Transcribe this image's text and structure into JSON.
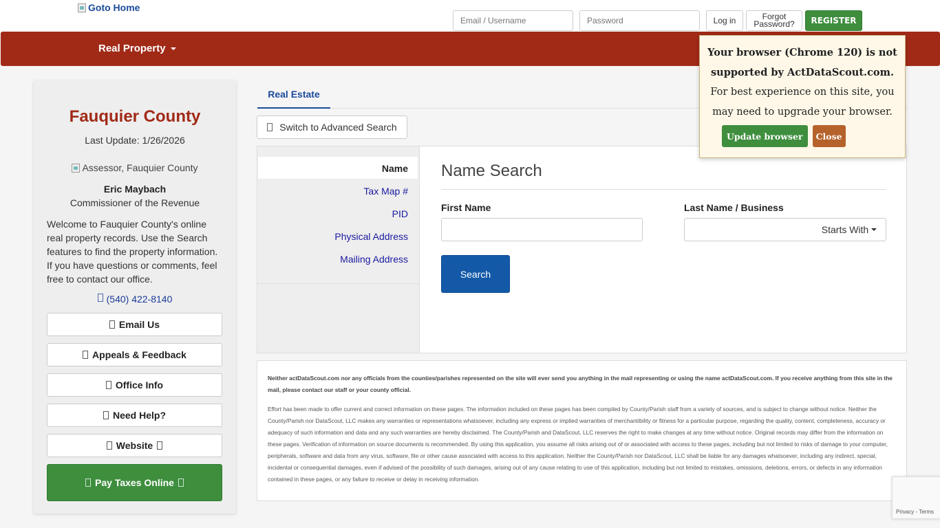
{
  "header": {
    "logo_alt": "Goto Home",
    "email_placeholder": "Email / Username",
    "password_placeholder": "Password",
    "login_label": "Log in",
    "forgot_line1": "Forgot",
    "forgot_line2": "Password?",
    "register_label": "REGISTER"
  },
  "nav": {
    "real_property_label": "Real Property"
  },
  "sidebar": {
    "county": "Fauquier County",
    "last_update": "Last Update: 1/26/2026",
    "assessor_img_alt": "Assessor, Fauquier County",
    "official_name": "Eric Maybach",
    "official_title": "Commissioner of the Revenue",
    "welcome": "Welcome to Fauquier County's online real property records. Use the Search features to find the property information. If you have questions or comments, feel free to contact our office.",
    "phone": "(540) 422-8140",
    "buttons": {
      "email": "Email Us",
      "appeals": "Appeals & Feedback",
      "office": "Office Info",
      "help": "Need Help?",
      "website": "Website"
    },
    "pay_taxes": "Pay Taxes Online"
  },
  "tabs": {
    "real_estate": "Real Estate"
  },
  "advanced_search_label": "Switch to Advanced Search",
  "search": {
    "options": [
      "Name",
      "Tax Map #",
      "PID",
      "Physical Address",
      "Mailing Address"
    ],
    "title": "Name Search",
    "first_name_label": "First Name",
    "last_name_label": "Last Name / Business",
    "starts_with_label": "Starts With",
    "search_button": "Search"
  },
  "disclaimer": {
    "bold": "Neither actDataScout.com nor any officials from the counties/parishes represented on the site will ever send you anything in the mail representing or using the name actDataScout.com. If you receive anything from this site in the mail, please contact our staff or your county official.",
    "text": "Effort has been made to offer current and correct information on these pages. The information included on these pages has been compiled by County/Parish staff from a variety of sources, and is subject to change without notice. Neither the County/Parish nor DataScout, LLC makes any warranties or representations whatsoever, including any express or implied warranties of merchantibility or fitness for a particular purpose, regarding the quality, content, completeness, accuracy or adequacy of such information and data and any such warranties are hereby disclaimed. The County/Parish and DataScout, LLC reserves the right to make changes at any time without notice. Original records may differ from the information on these pages. Verification of information on source documents is recommended. By using this application, you assume all risks arising out of or associated with access to these pages, including but not limited to risks of damage to your computer, peripherals, software and data from any virus, software, file or other cause associated with access to this application. Neither the County/Parish nor DataScout, LLC shall be liable for any damages whatsoever, including any indirect, special, incidental or consequential damages, even if advised of the possibility of such damages, arising out of any cause relating to use of this application, including but not limited to mistakes, omissions, deletions, errors, or defects in any information contained in these pages, or any failure to receive or delay in receiving information."
  },
  "popup": {
    "line1": "Your browser (Chrome 120) is not supported by ActDataScout.com.",
    "line2": "For best experience on this site, you may need to upgrade your browser.",
    "update_label": "Update browser",
    "close_label": "Close"
  },
  "recaptcha": {
    "privacy": "Privacy",
    "sep": " - ",
    "terms": "Terms"
  },
  "colors": {
    "brand_red": "#a12a17",
    "green": "#3e8e3e",
    "blue": "#1359a8"
  }
}
